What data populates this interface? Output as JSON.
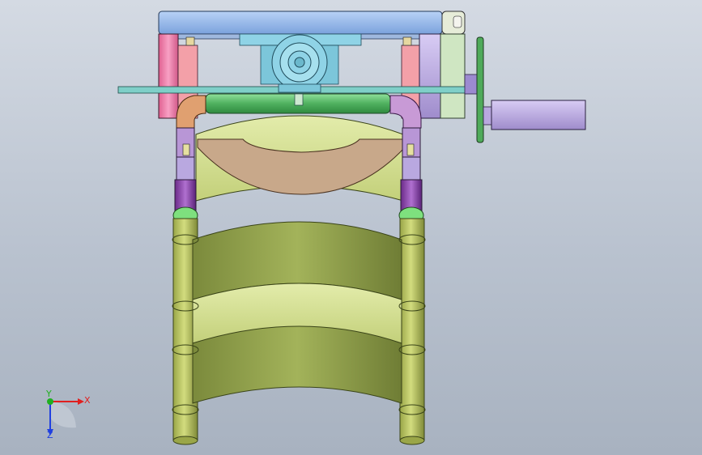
{
  "triad": {
    "x_label": "X",
    "y_label": "Y",
    "z_label": "Z",
    "x_color": "#e02020",
    "y_color": "#20b020",
    "z_color": "#2040e0"
  },
  "colors": {
    "frame_blue": "#8fb5e8",
    "motor_cyan": "#8fd3e6",
    "bracket_pink": "#f07aa8",
    "tube_green": "#5fbf6f",
    "elbow_orange": "#e0a070",
    "clamp_purple": "#8a3fa8",
    "pad_tan": "#c8a88a",
    "shell_olive": "#8a9a4a",
    "shell_inner": "#d6e29a",
    "actuator_lavender": "#b9a8e0",
    "flange_green": "#4faa5a"
  },
  "icons": {
    "coordinate_triad": "axis-triad-icon"
  }
}
